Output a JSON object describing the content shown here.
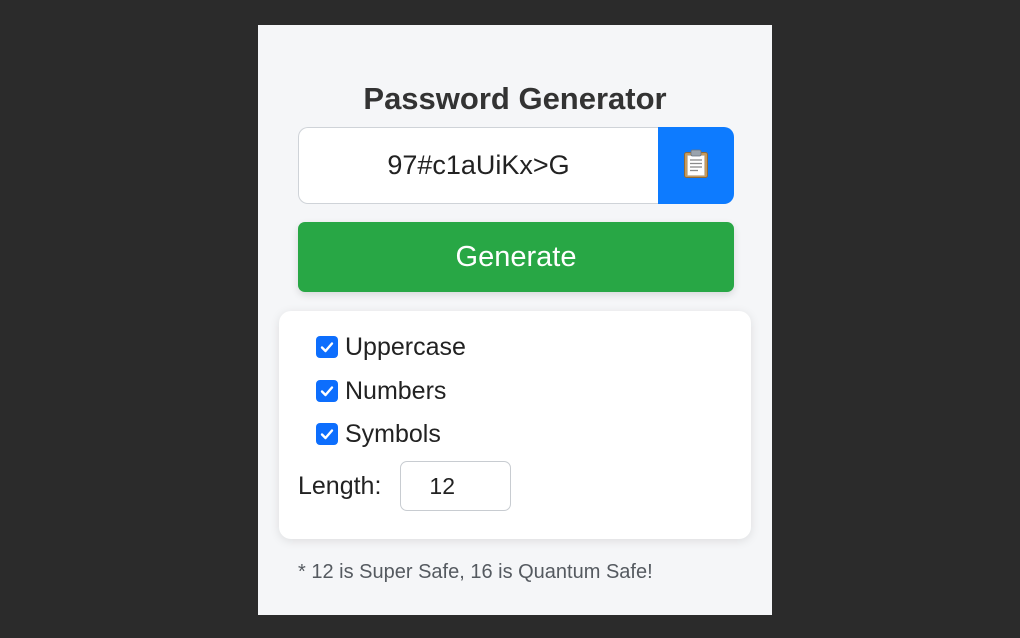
{
  "app": {
    "title": "Password Generator"
  },
  "password": {
    "value": "97#c1aUiKx>G",
    "copy_icon": "clipboard-icon"
  },
  "generate": {
    "label": "Generate"
  },
  "options": {
    "items": [
      {
        "label": "Uppercase",
        "checked": true
      },
      {
        "label": "Numbers",
        "checked": true
      },
      {
        "label": "Symbols",
        "checked": true
      }
    ],
    "length_label": "Length:",
    "length_value": "12"
  },
  "note": "* 12 is Super Safe, 16 is Quantum Safe!",
  "colors": {
    "background": "#2b2b2b",
    "panel": "#f5f6f8",
    "copy_button": "#0d7bff",
    "generate_button": "#28a745",
    "checkbox": "#0d6efd"
  }
}
